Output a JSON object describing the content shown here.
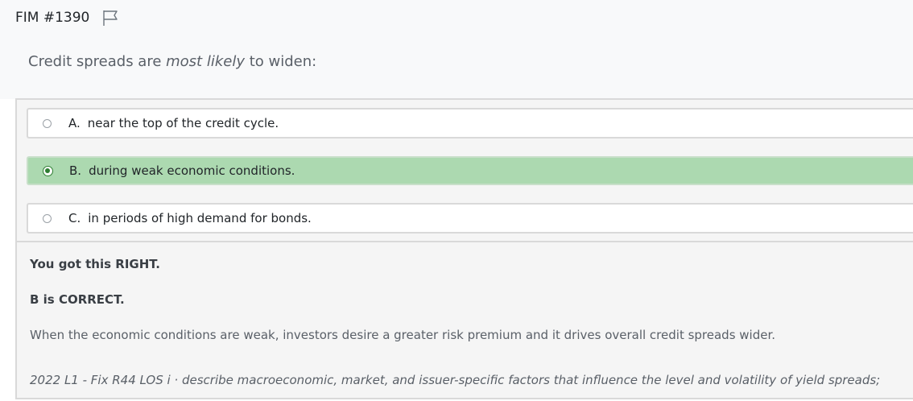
{
  "question_id": "FIM #1390",
  "question": {
    "before": "Credit spreads are ",
    "emphasis": "most likely",
    "after": " to widen:"
  },
  "choices": [
    {
      "letter": "A.",
      "text": "near the top of the credit cycle.",
      "selected": false
    },
    {
      "letter": "B.",
      "text": "during weak economic conditions.",
      "selected": true
    },
    {
      "letter": "C.",
      "text": "in periods of high demand for bonds.",
      "selected": false
    }
  ],
  "feedback": {
    "result": "You got this RIGHT.",
    "correct": "B is CORRECT.",
    "explanation": "When the economic conditions are weak, investors desire a greater risk premium and it drives overall credit spreads wider.",
    "los": "2022 L1 - Fix R44 LOS i · describe macroeconomic, market, and issuer-specific factors that influence the level and volatility of yield spreads;"
  },
  "colors": {
    "selected_background": "#acd9b0",
    "radio_checked": "#2e7d32"
  },
  "icons": {
    "flag": "flag-icon"
  }
}
